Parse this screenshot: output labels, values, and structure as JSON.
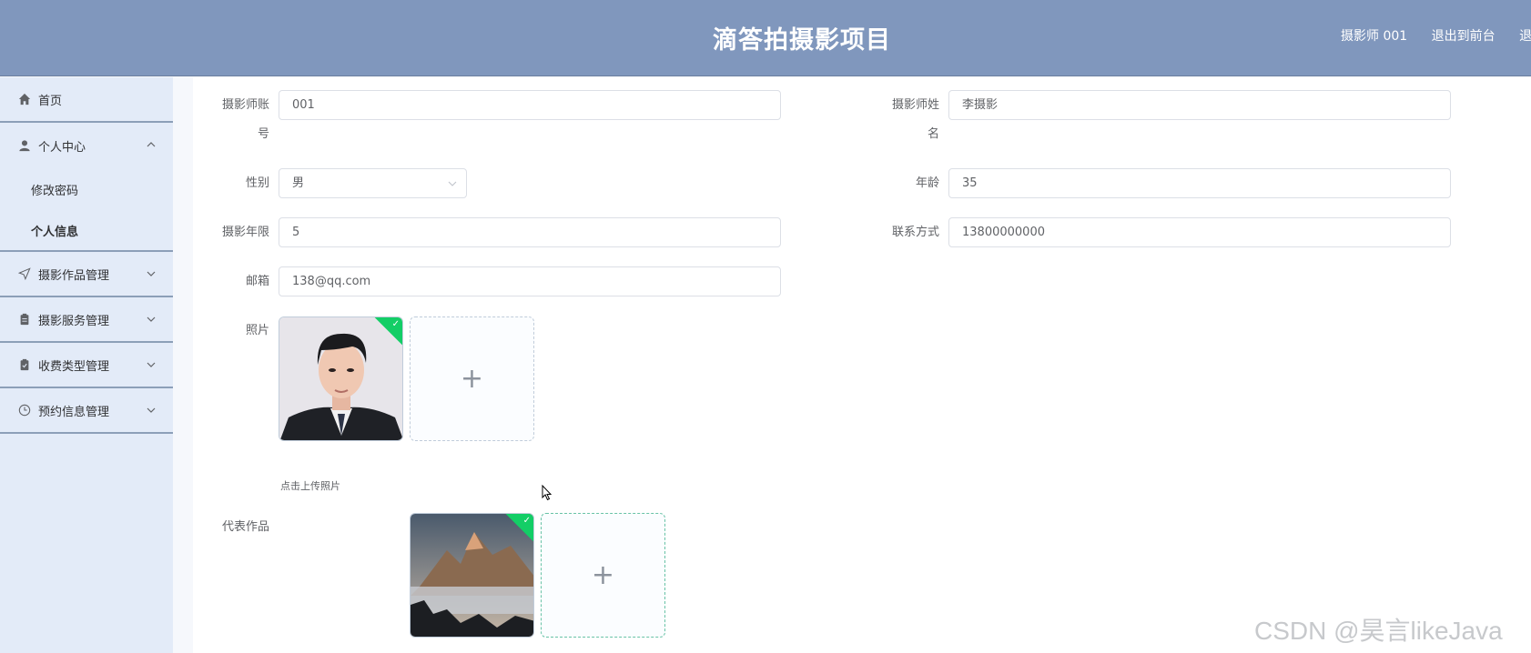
{
  "header": {
    "title": "滴答拍摄影项目",
    "user": "摄影师 001",
    "back_to_front": "退出到前台",
    "logout": "退出"
  },
  "sidebar": {
    "items": [
      {
        "label": "首页",
        "icon": "home-icon"
      },
      {
        "label": "个人中心",
        "icon": "user-icon",
        "expanded": true,
        "children": [
          {
            "label": "修改密码"
          },
          {
            "label": "个人信息",
            "active": true
          }
        ]
      },
      {
        "label": "摄影作品管理",
        "icon": "send-icon"
      },
      {
        "label": "摄影服务管理",
        "icon": "clipboard-icon"
      },
      {
        "label": "收费类型管理",
        "icon": "document-icon"
      },
      {
        "label": "预约信息管理",
        "icon": "clock-icon"
      }
    ]
  },
  "form": {
    "account_label": "摄影师账号",
    "account_value": "001",
    "name_label": "摄影师姓名",
    "name_value": "李摄影",
    "gender_label": "性别",
    "gender_value": "男",
    "age_label": "年龄",
    "age_value": "35",
    "years_label": "摄影年限",
    "years_value": "5",
    "contact_label": "联系方式",
    "contact_value": "13800000000",
    "email_label": "邮箱",
    "email_value": "138@qq.com",
    "photo_label": "照片",
    "photo_hint": "点击上传照片",
    "works_label": "代表作品"
  },
  "watermark": "CSDN @昊言likeJava",
  "colors": {
    "header_bg": "#8097bd",
    "sidebar_bg": "#e3ebf8",
    "success_badge": "#13ce66"
  }
}
